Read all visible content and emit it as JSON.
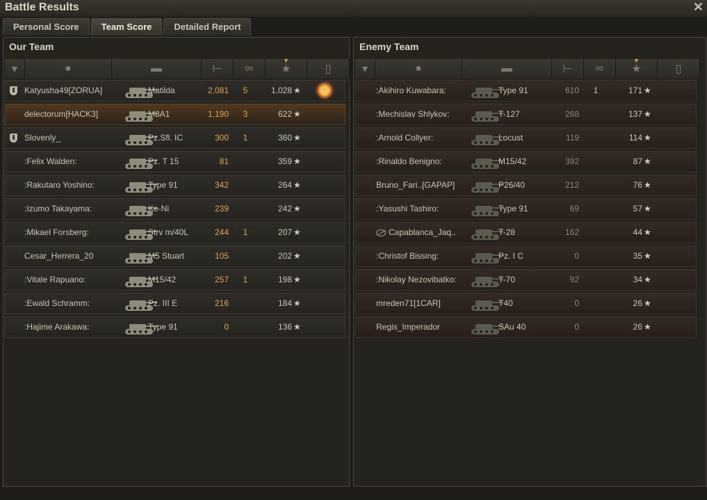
{
  "window": {
    "title": "Battle Results",
    "close_icon": "close-icon"
  },
  "tabs": [
    {
      "label": "Personal Score",
      "active": false
    },
    {
      "label": "Team Score",
      "active": true
    },
    {
      "label": "Detailed Report",
      "active": false
    }
  ],
  "columns": [
    "platoon",
    "player",
    "vehicle",
    "damage",
    "kills",
    "xp",
    "medals"
  ],
  "our_team": {
    "title": "Our Team",
    "rows": [
      {
        "platoon": true,
        "name": "Katyusha49[ZORUA]",
        "vehicle": "Matilda",
        "damage": "2,081",
        "kills": "5",
        "xp": "1,028",
        "medal": true,
        "style": "platoon"
      },
      {
        "platoon": false,
        "name": "delectorum[HACK3]",
        "vehicle": "M8A1",
        "damage": "1,190",
        "kills": "3",
        "xp": "622",
        "medal": false,
        "style": "self"
      },
      {
        "platoon": true,
        "name": "Slovenly_",
        "vehicle": "Pz.Sfl. IC",
        "damage": "300",
        "kills": "1",
        "xp": "360",
        "medal": false,
        "style": "platoon"
      },
      {
        "platoon": false,
        "name": ":Felix Walden:",
        "vehicle": "Pz. T 15",
        "damage": "81",
        "kills": "",
        "xp": "359",
        "medal": false,
        "style": "normal"
      },
      {
        "platoon": false,
        "name": ":Rakutaro Yoshino:",
        "vehicle": "Type 91",
        "damage": "342",
        "kills": "",
        "xp": "264",
        "medal": false,
        "style": "normal"
      },
      {
        "platoon": false,
        "name": ":Izumo Takayama:",
        "vehicle": "Ke-Ni",
        "damage": "239",
        "kills": "",
        "xp": "242",
        "medal": false,
        "style": "normal"
      },
      {
        "platoon": false,
        "name": ":Mikael Forsberg:",
        "vehicle": "Strv m/40L",
        "damage": "244",
        "kills": "1",
        "xp": "207",
        "medal": false,
        "style": "normal"
      },
      {
        "platoon": false,
        "name": "Cesar_Herrera_20",
        "vehicle": "M5 Stuart",
        "damage": "105",
        "kills": "",
        "xp": "202",
        "medal": false,
        "style": "normal"
      },
      {
        "platoon": false,
        "name": ":Vitale Rapuano:",
        "vehicle": "M15/42",
        "damage": "257",
        "kills": "1",
        "xp": "198",
        "medal": false,
        "style": "normal"
      },
      {
        "platoon": false,
        "name": ":Ewald Schramm:",
        "vehicle": "Pz. III E",
        "damage": "216",
        "kills": "",
        "xp": "184",
        "medal": false,
        "style": "normal"
      },
      {
        "platoon": false,
        "name": ":Hajime Arakawa:",
        "vehicle": "Type 91",
        "damage": "0",
        "kills": "",
        "xp": "136",
        "medal": false,
        "style": "normal"
      }
    ]
  },
  "enemy_team": {
    "title": "Enemy Team",
    "rows": [
      {
        "name": ":Akihiro Kuwabara:",
        "vehicle": "Type 91",
        "damage": "610",
        "kills": "1",
        "xp": "171",
        "hidden": false
      },
      {
        "name": ":Mechislav Shlykov:",
        "vehicle": "T-127",
        "damage": "268",
        "kills": "",
        "xp": "137",
        "hidden": false
      },
      {
        "name": ":Arnold Collyer:",
        "vehicle": "Locust",
        "damage": "119",
        "kills": "",
        "xp": "114",
        "hidden": false
      },
      {
        "name": ":Rinaldo Benigno:",
        "vehicle": "M15/42",
        "damage": "392",
        "kills": "",
        "xp": "87",
        "hidden": false
      },
      {
        "name": "Bruno_Fari..[GAPAP]",
        "vehicle": "P26/40",
        "damage": "212",
        "kills": "",
        "xp": "76",
        "hidden": false
      },
      {
        "name": ":Yasushi Tashiro:",
        "vehicle": "Type 91",
        "damage": "69",
        "kills": "",
        "xp": "57",
        "hidden": false
      },
      {
        "name": "Capablanca_Jaq..",
        "vehicle": "T-28",
        "damage": "162",
        "kills": "",
        "xp": "44",
        "hidden": true
      },
      {
        "name": ":Christof Bissing:",
        "vehicle": "Pz. I C",
        "damage": "0",
        "kills": "",
        "xp": "35",
        "hidden": false
      },
      {
        "name": ":Nikolay Nezovibatko:",
        "vehicle": "T-70",
        "damage": "92",
        "kills": "",
        "xp": "34",
        "hidden": false
      },
      {
        "name": "mreden71[1CAR]",
        "vehicle": "T40",
        "damage": "0",
        "kills": "",
        "xp": "26",
        "hidden": false
      },
      {
        "name": "Regis_Imperador",
        "vehicle": "SAu 40",
        "damage": "0",
        "kills": "",
        "xp": "26",
        "hidden": false
      }
    ]
  },
  "colors": {
    "accent": "#e0a64b",
    "self_row": "#4f3820",
    "enemy_row": "#332a25"
  }
}
